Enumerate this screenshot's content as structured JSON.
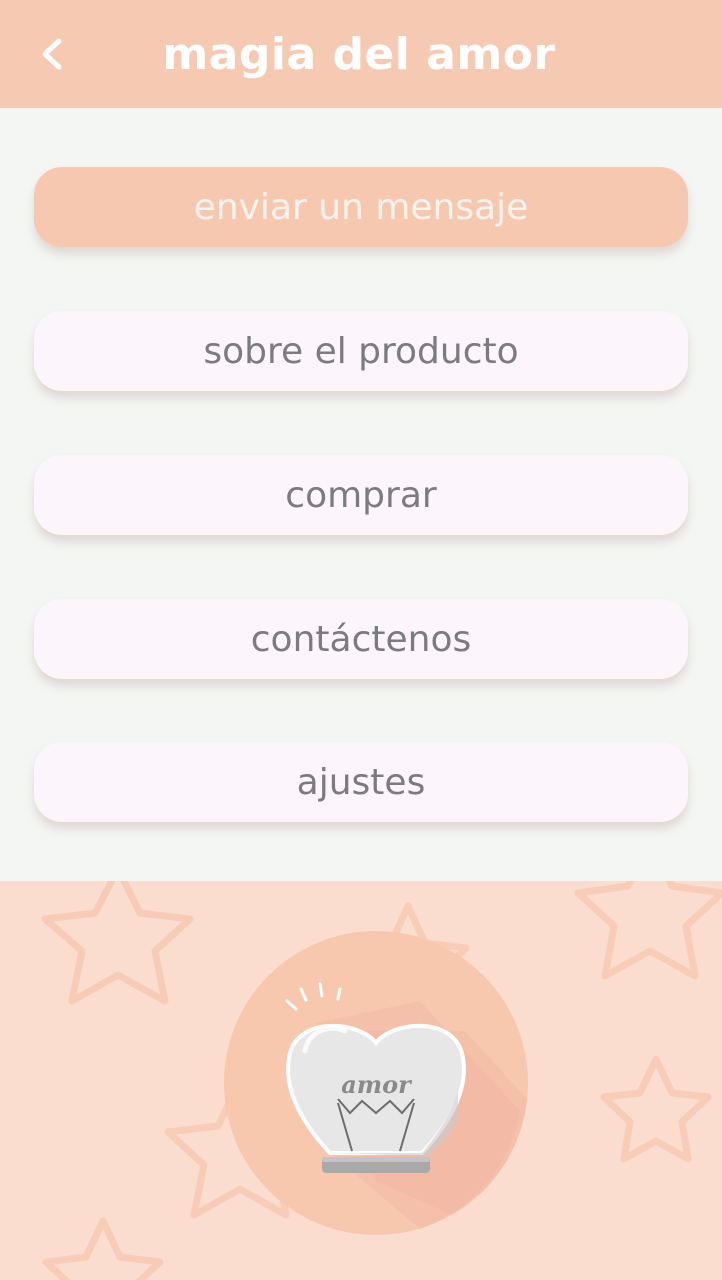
{
  "header": {
    "title": "magia del amor",
    "back_icon": "chevron-left-icon"
  },
  "menu": {
    "items": [
      {
        "label": "enviar un mensaje",
        "active": true
      },
      {
        "label": "sobre el producto",
        "active": false
      },
      {
        "label": "comprar",
        "active": false
      },
      {
        "label": "contáctenos",
        "active": false
      },
      {
        "label": "ajustes",
        "active": false
      }
    ]
  },
  "illustration": {
    "lamp_text": "amor"
  },
  "colors": {
    "header_bg": "#f6cab2",
    "page_bg": "#f4f6f4",
    "button_bg": "#fdf5fc",
    "button_active_bg": "#f6c8b0",
    "button_text": "#7b7b80",
    "bottom_bg": "#fbddd0"
  }
}
